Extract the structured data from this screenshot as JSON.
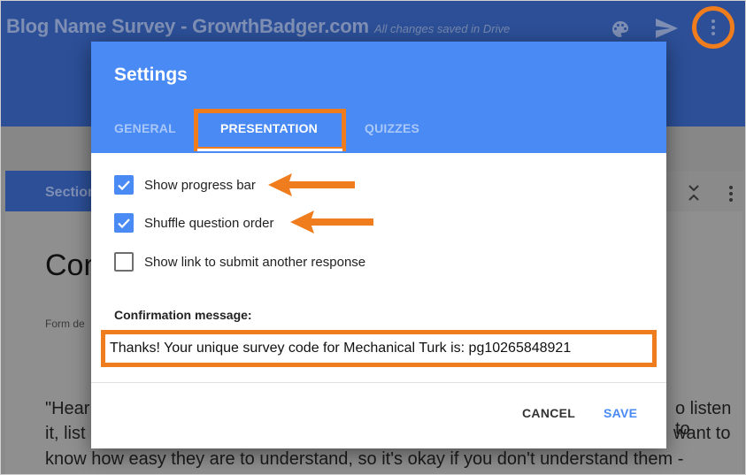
{
  "app": {
    "title": "Blog Name Survey - GrowthBadger.com",
    "save_status": "All changes saved in Drive"
  },
  "background": {
    "section_label": "Section",
    "form_heading_partial": "Con",
    "form_description_partial": "Form de",
    "body_line1_left": "\"Hear",
    "body_line1_right": "o listen to",
    "body_line2_left": "it, list",
    "body_line2_right": "want to",
    "body_line3": "know how easy they are to understand, so it's okay if you don't understand them -"
  },
  "dialog": {
    "title": "Settings",
    "tabs": [
      {
        "label": "GENERAL",
        "active": false
      },
      {
        "label": "PRESENTATION",
        "active": true
      },
      {
        "label": "QUIZZES",
        "active": false
      }
    ],
    "options": [
      {
        "label": "Show progress bar",
        "checked": true
      },
      {
        "label": "Shuffle question order",
        "checked": true
      },
      {
        "label": "Show link to submit another response",
        "checked": false
      }
    ],
    "confirmation": {
      "label": "Confirmation message:",
      "value": "Thanks! Your unique survey code for Mechanical Turk is: pg10265848921"
    },
    "buttons": {
      "cancel": "CANCEL",
      "save": "SAVE"
    }
  },
  "icons": {
    "palette": "palette-icon",
    "send": "send-icon",
    "more": "more-vert-icon",
    "collapse": "collapse-icon",
    "check": "check-icon",
    "annotation_arrow": "arrow-left-icon"
  },
  "colors": {
    "header_blue": "#4a8af4",
    "appbar_blue": "#2c4f97",
    "highlight_orange": "#ef7d1e"
  }
}
